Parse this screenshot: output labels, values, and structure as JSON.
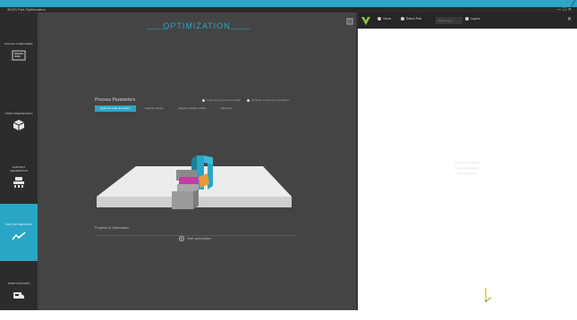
{
  "titlebar": {
    "app_title": "3DGS Part Optimization",
    "window_controls": "— ☐ ✕"
  },
  "colors": {
    "accent": "#2aa6c6",
    "sidebar_bg": "#2c2c2c",
    "main_bg": "#444444",
    "toolbar_bg": "#262626"
  },
  "sidebar": {
    "items": [
      {
        "label": "DIGITAL COMPONENT",
        "icon": "component-icon"
      },
      {
        "label": "PRINT PREPARATION",
        "icon": "cube-icon"
      },
      {
        "label": "SUPPORT GENERATION",
        "icon": "support-icon"
      },
      {
        "label": "PART OPTIMIZATION",
        "icon": "chart-line-icon"
      },
      {
        "label": "PRINT PROCESS",
        "icon": "printer-icon"
      }
    ]
  },
  "main": {
    "title": "OPTIMIZATION",
    "options_title": "Process Parameters",
    "radio_options": [
      "Keep full component in build",
      "Optimize component orientation"
    ],
    "tabs": [
      "Optimize build orientation",
      "Support volume",
      "Support contact surface",
      "Distortion"
    ],
    "bottom_title": "Progress of Optimization",
    "bottom_button": "Start optimization"
  },
  "right_panel": {
    "toolbar": [
      "Views",
      "Select Part",
      "Show Layer",
      "Layers"
    ],
    "search_placeholder": "",
    "empty_message": [
      "No results to display",
      "Run an optimization to",
      "show results here"
    ]
  }
}
